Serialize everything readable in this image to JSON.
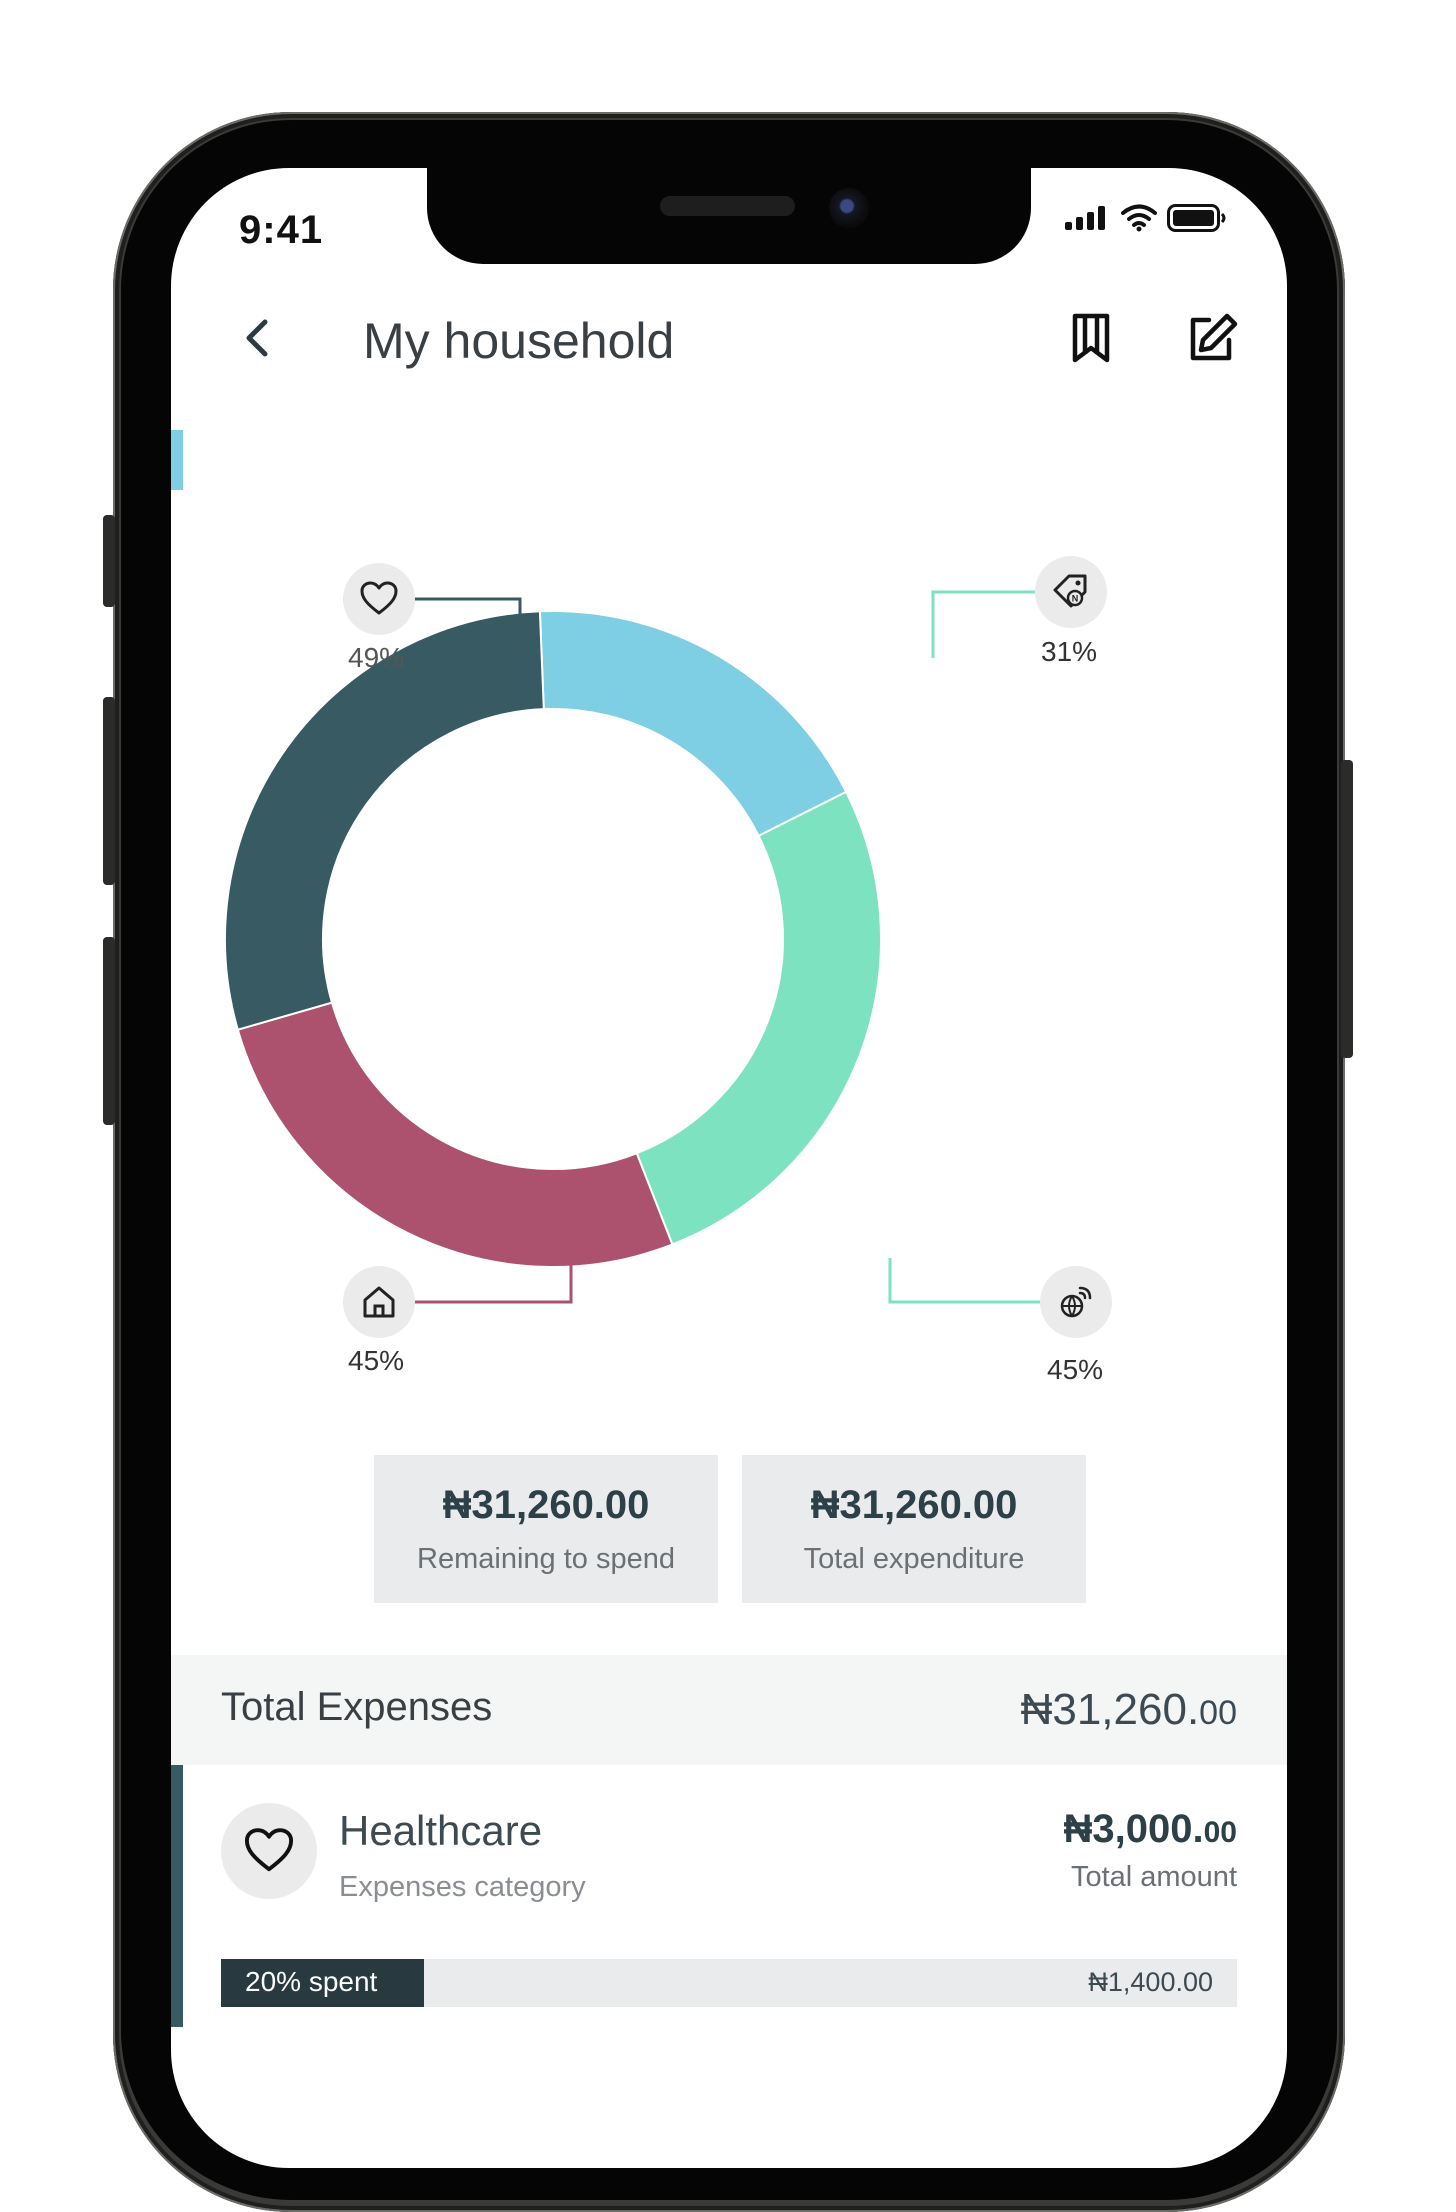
{
  "status_bar": {
    "time": "9:41"
  },
  "header": {
    "title": "My household"
  },
  "chart_data": {
    "type": "pie",
    "categories": [
      "Healthcare",
      "Shopping",
      "Internet",
      "Housing"
    ],
    "category_icons": [
      "heart-icon",
      "price-tag-icon",
      "globe-signal-icon",
      "home-icon"
    ],
    "values": [
      49,
      31,
      45,
      45
    ],
    "colors": [
      "#385a62",
      "#7ecfe4",
      "#7de2c0",
      "#ad526e"
    ],
    "labels": [
      "49%",
      "31%",
      "45%",
      "45%"
    ]
  },
  "summary": {
    "remaining": {
      "amount": "₦31,260.00",
      "label": "Remaining to spend"
    },
    "expenditure": {
      "amount": "₦31,260.00",
      "label": "Total expenditure"
    }
  },
  "expenses": {
    "title": "Total Expenses",
    "total_main": "₦31,260.",
    "total_decimal": "00",
    "items": [
      {
        "name": "Healthcare",
        "subtitle": "Expenses category",
        "amount_main": "₦3,000.",
        "amount_decimal": "00",
        "amount_label": "Total amount",
        "progress_label": "20% spent",
        "progress_fraction": 0.2,
        "progress_amount": "₦1,400.00",
        "icon": "heart-icon"
      }
    ]
  }
}
